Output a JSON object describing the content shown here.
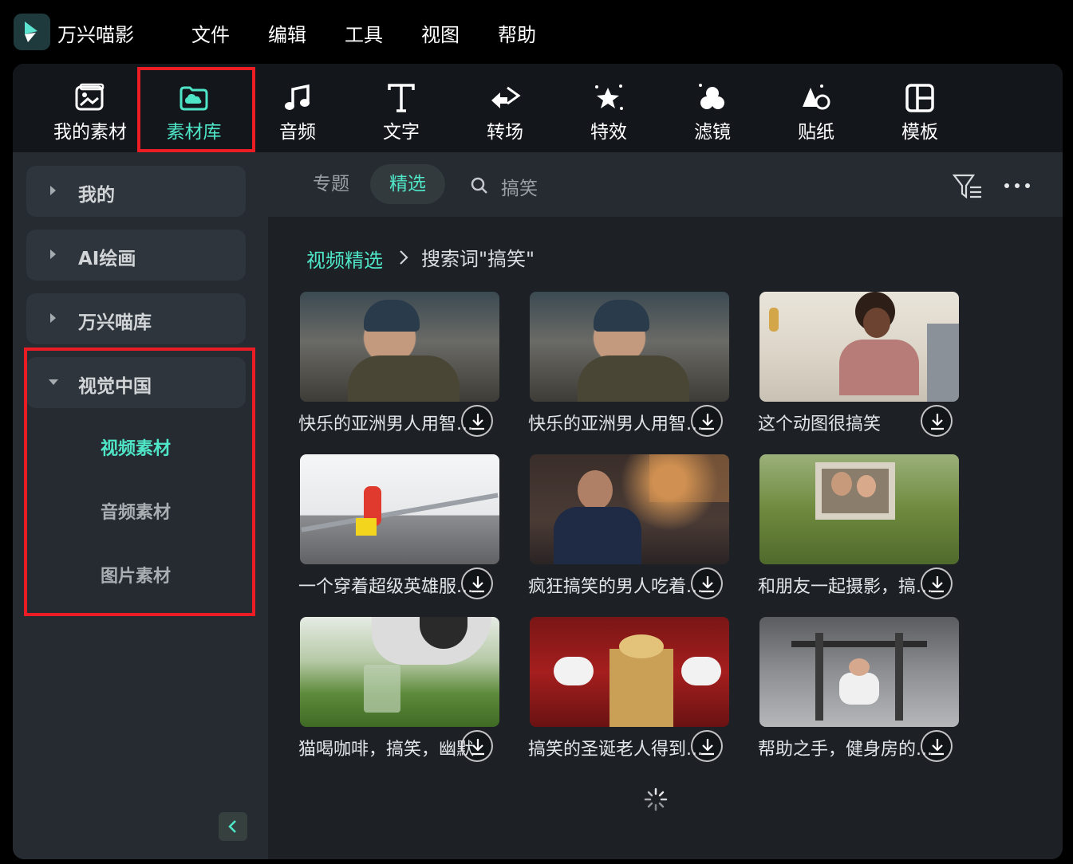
{
  "app": {
    "title": "万兴喵影"
  },
  "menu": [
    "文件",
    "编辑",
    "工具",
    "视图",
    "帮助"
  ],
  "toolbar": [
    {
      "label": "我的素材",
      "icon": "image-icon"
    },
    {
      "label": "素材库",
      "icon": "cloud-folder-icon",
      "active": true
    },
    {
      "label": "音频",
      "icon": "music-note-icon"
    },
    {
      "label": "文字",
      "icon": "text-t-icon"
    },
    {
      "label": "转场",
      "icon": "transition-arrows-icon"
    },
    {
      "label": "特效",
      "icon": "star-sparkle-icon"
    },
    {
      "label": "滤镜",
      "icon": "filter-circles-icon"
    },
    {
      "label": "贴纸",
      "icon": "sticker-shapes-icon"
    },
    {
      "label": "模板",
      "icon": "template-layout-icon"
    }
  ],
  "sidebar": {
    "items": [
      {
        "label": "我的",
        "expanded": false
      },
      {
        "label": "AI绘画",
        "expanded": false
      },
      {
        "label": "万兴喵库",
        "expanded": false
      },
      {
        "label": "视觉中国",
        "expanded": true
      }
    ],
    "subitems": [
      {
        "label": "视频素材",
        "active": true
      },
      {
        "label": "音频素材",
        "active": false
      },
      {
        "label": "图片素材",
        "active": false
      }
    ]
  },
  "tabs": {
    "topics": "专题",
    "featured": "精选"
  },
  "search": {
    "query": "搞笑"
  },
  "breadcrumb": {
    "parent": "视频精选",
    "current": "搜索词\"搞笑\""
  },
  "cards": [
    {
      "title": "快乐的亚洲男人用智..."
    },
    {
      "title": "快乐的亚洲男人用智..."
    },
    {
      "title": "这个动图很搞笑"
    },
    {
      "title": "一个穿着超级英雄服..."
    },
    {
      "title": "疯狂搞笑的男人吃着..."
    },
    {
      "title": "和朋友一起摄影，搞..."
    },
    {
      "title": "猫喝咖啡，搞笑，幽默"
    },
    {
      "title": "搞笑的圣诞老人得到..."
    },
    {
      "title": "帮助之手，健身房的..."
    }
  ],
  "colors": {
    "accent": "#4fe6c8",
    "highlight": "#ec1c24",
    "panel": "#262b31",
    "content": "#1d2126",
    "toolbar": "#13171c"
  }
}
